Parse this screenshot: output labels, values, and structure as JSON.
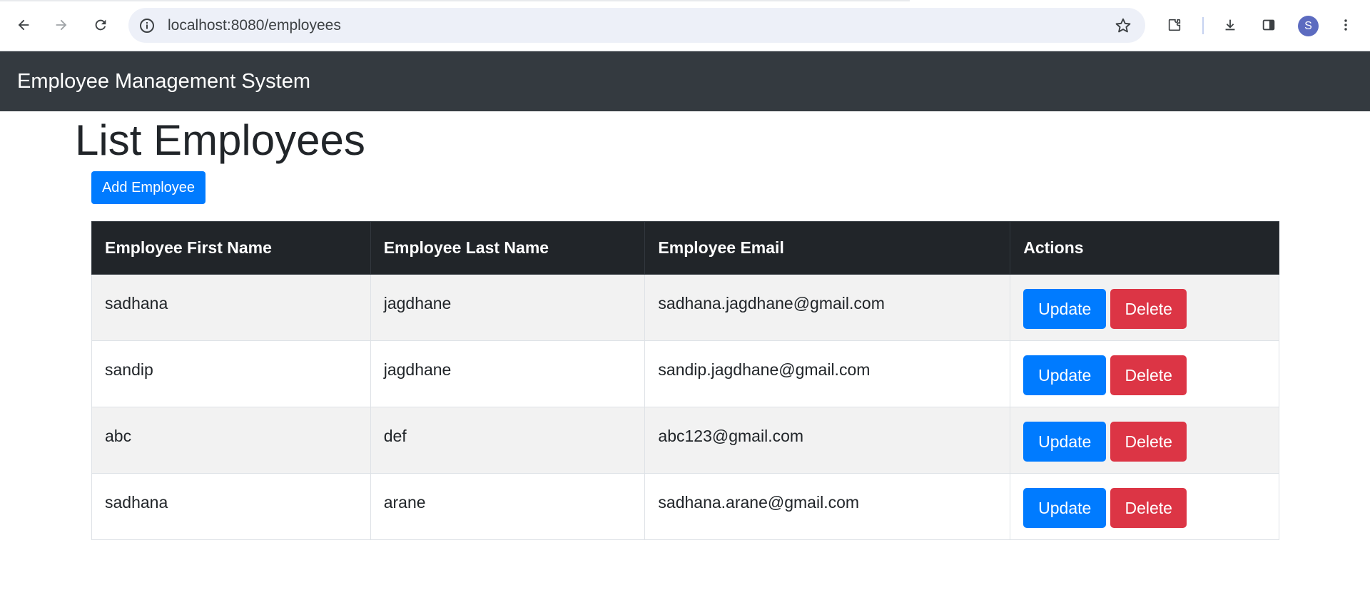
{
  "browser": {
    "url": "localhost:8080/employees",
    "avatar_letter": "S",
    "icons": [
      "back-arrow-icon",
      "forward-arrow-icon",
      "reload-icon",
      "info-icon",
      "bookmark-star-icon",
      "extensions-icon",
      "download-icon",
      "side-panel-icon",
      "more-vert-icon"
    ]
  },
  "navbar": {
    "brand": "Employee Management System"
  },
  "page": {
    "title": "List Employees",
    "add_button": "Add Employee"
  },
  "table": {
    "headers": [
      "Employee First Name",
      "Employee Last Name",
      "Employee Email",
      "Actions"
    ],
    "rows": [
      {
        "first_name": "sadhana",
        "last_name": "jagdhane",
        "email": "sadhana.jagdhane@gmail.com"
      },
      {
        "first_name": "sandip",
        "last_name": "jagdhane",
        "email": "sandip.jagdhane@gmail.com"
      },
      {
        "first_name": "abc",
        "last_name": "def",
        "email": "abc123@gmail.com"
      },
      {
        "first_name": "sadhana",
        "last_name": "arane",
        "email": "sadhana.arane@gmail.com"
      }
    ],
    "update_label": "Update",
    "delete_label": "Delete"
  },
  "colors": {
    "navbar_bg": "#343a40",
    "table_header_bg": "#212529",
    "primary": "#007bff",
    "danger": "#dc3545",
    "striped_row": "#f2f2f2"
  }
}
